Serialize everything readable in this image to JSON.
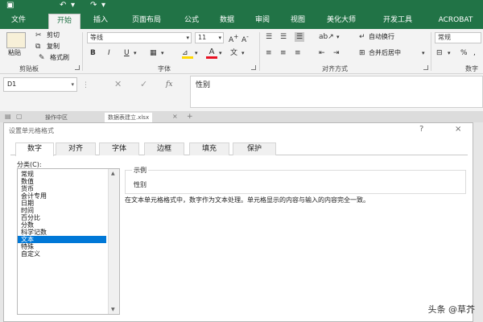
{
  "ribbon_tabs": [
    "文件",
    "开始",
    "插入",
    "页面布局",
    "公式",
    "数据",
    "审阅",
    "视图",
    "美化大师",
    "开发工具",
    "ACROBAT"
  ],
  "clipboard": {
    "paste": "粘贴",
    "cut": "剪切",
    "copy": "复制",
    "format_painter": "格式刷",
    "group": "剪贴板"
  },
  "font": {
    "name": "等线",
    "size": "11",
    "group": "字体"
  },
  "alignment": {
    "wrap_text": "自动换行",
    "merge_center": "合并后居中",
    "group": "对齐方式"
  },
  "number": {
    "format": "常规",
    "group": "数字"
  },
  "name_box": "D1",
  "formula_value": "性别",
  "workbook_tabs": [
    "操作中区",
    "数据表建立.xlsx"
  ],
  "dialog": {
    "title": "设置单元格格式",
    "help": "?",
    "close": "×",
    "tabs": [
      "数字",
      "对齐",
      "字体",
      "边框",
      "填充",
      "保护"
    ],
    "category_label": "分类(C):",
    "categories": [
      "常规",
      "数值",
      "货币",
      "会计专用",
      "日期",
      "时间",
      "百分比",
      "分数",
      "科学记数",
      "文本",
      "特殊",
      "自定义"
    ],
    "selected_category": "文本",
    "sample_label": "示例",
    "sample_value": "性别",
    "description": "在文本单元格格式中，数字作为文本处理。单元格显示的内容与输入的内容完全一致。"
  },
  "watermark": "头条 @草芥",
  "colors": {
    "excel_green": "#217346",
    "selection_blue": "#0078d7",
    "font_color_red": "#e81123",
    "highlight_yellow": "#ffd800"
  }
}
